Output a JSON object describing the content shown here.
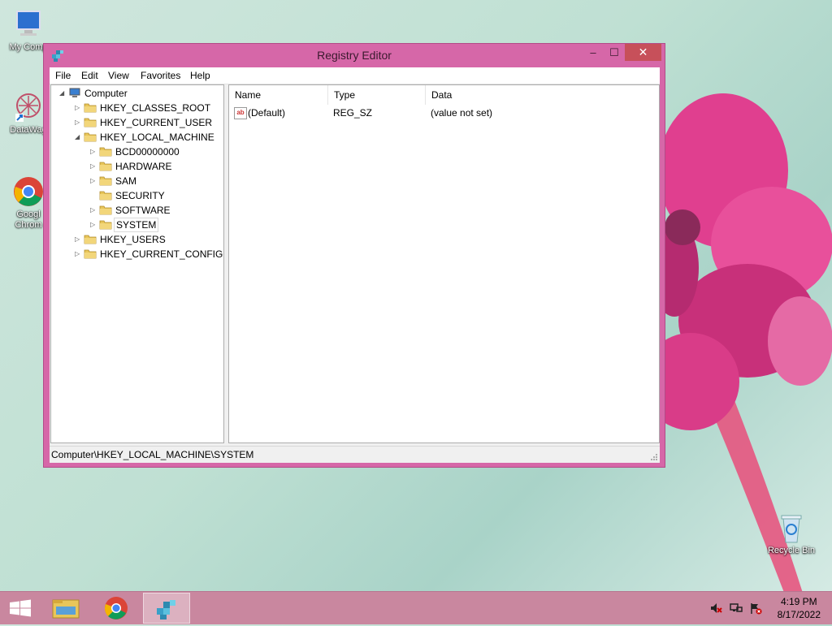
{
  "desktop": {
    "icons": [
      {
        "label": "My Comp"
      },
      {
        "label": "DataWag"
      },
      {
        "label": "Googl Chrom"
      },
      {
        "label": "Recycle Bin"
      }
    ]
  },
  "window": {
    "title": "Registry Editor",
    "controls": {
      "minimize": "–",
      "maximize": "☐",
      "close": "✕"
    },
    "menu": [
      "File",
      "Edit",
      "View",
      "Favorites",
      "Help"
    ],
    "tree": [
      {
        "label": "Computer",
        "level": 0,
        "expander": "◢"
      },
      {
        "label": "HKEY_CLASSES_ROOT",
        "level": 1,
        "expander": "▷"
      },
      {
        "label": "HKEY_CURRENT_USER",
        "level": 1,
        "expander": "▷"
      },
      {
        "label": "HKEY_LOCAL_MACHINE",
        "level": 1,
        "expander": "◢"
      },
      {
        "label": "BCD00000000",
        "level": 2,
        "expander": "▷"
      },
      {
        "label": "HARDWARE",
        "level": 2,
        "expander": "▷"
      },
      {
        "label": "SAM",
        "level": 2,
        "expander": "▷"
      },
      {
        "label": "SECURITY",
        "level": 2,
        "expander": ""
      },
      {
        "label": "SOFTWARE",
        "level": 2,
        "expander": "▷"
      },
      {
        "label": "SYSTEM",
        "level": 2,
        "expander": "▷",
        "selected": true
      },
      {
        "label": "HKEY_USERS",
        "level": 1,
        "expander": "▷"
      },
      {
        "label": "HKEY_CURRENT_CONFIG",
        "level": 1,
        "expander": "▷"
      }
    ],
    "columns": [
      "Name",
      "Type",
      "Data"
    ],
    "values": [
      {
        "name": "(Default)",
        "type": "REG_SZ",
        "data": "(value not set)",
        "icon": "ab"
      }
    ],
    "status": "Computer\\HKEY_LOCAL_MACHINE\\SYSTEM"
  },
  "taskbar": {
    "clock_time": "4:19 PM",
    "clock_date": "8/17/2022"
  },
  "colors": {
    "window_frame": "#d667a8",
    "close_button": "#c7505a",
    "taskbar": "#c9879f",
    "folder": "#e8c65a"
  }
}
